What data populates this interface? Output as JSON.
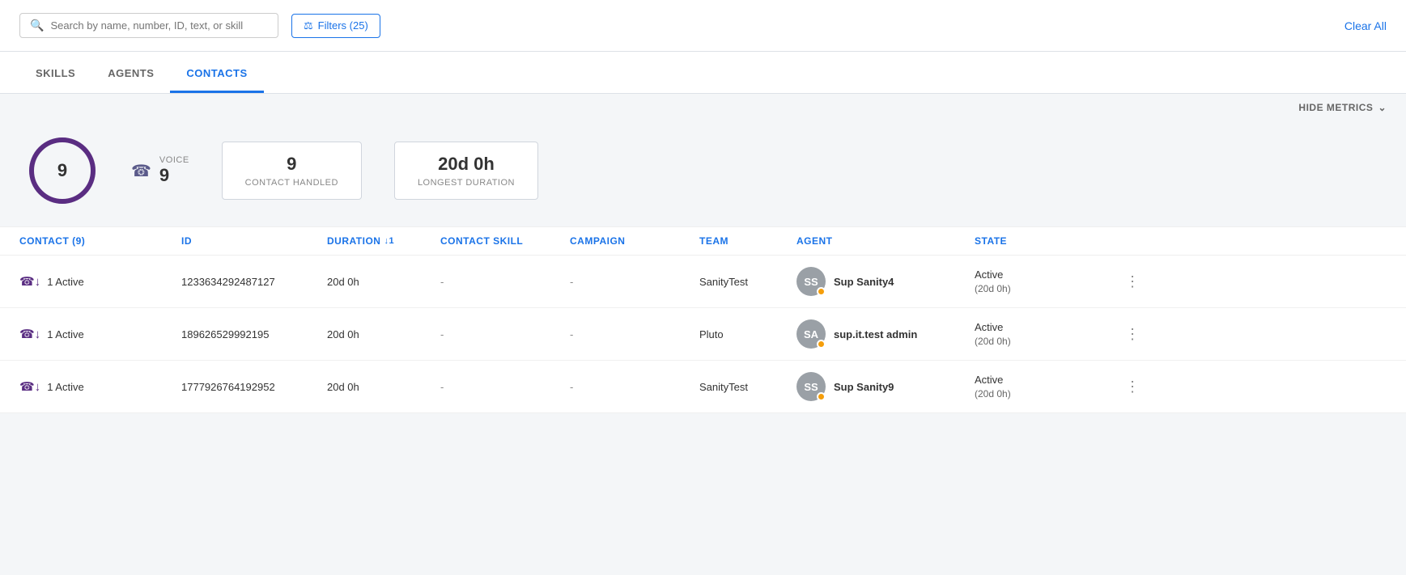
{
  "topbar": {
    "search_placeholder": "Search by name, number, ID, text, or skill",
    "filter_label": "Filters (25)",
    "clear_all_label": "Clear All"
  },
  "tabs": [
    {
      "id": "skills",
      "label": "SKILLS",
      "active": false
    },
    {
      "id": "agents",
      "label": "AGENTS",
      "active": false
    },
    {
      "id": "contacts",
      "label": "CONTACTS",
      "active": true
    }
  ],
  "metrics_toggle": {
    "label": "HIDE METRICS"
  },
  "metrics": {
    "total": 9,
    "voice_label": "VOICE",
    "voice_count": 9,
    "contact_handled_value": "9",
    "contact_handled_label": "CONTACT HANDLED",
    "longest_duration_value": "20d 0h",
    "longest_duration_label": "LONGEST DURATION"
  },
  "table": {
    "columns": [
      {
        "id": "contact",
        "label": "CONTACT (9)",
        "sortable": false
      },
      {
        "id": "id",
        "label": "ID",
        "sortable": false
      },
      {
        "id": "duration",
        "label": "DURATION",
        "sortable": true,
        "sort_indicator": "↓1"
      },
      {
        "id": "contact_skill",
        "label": "CONTACT SKILL",
        "sortable": false
      },
      {
        "id": "campaign",
        "label": "CAMPAIGN",
        "sortable": false
      },
      {
        "id": "team",
        "label": "TEAM",
        "sortable": false
      },
      {
        "id": "agent",
        "label": "AGENT",
        "sortable": false
      },
      {
        "id": "state",
        "label": "STATE",
        "sortable": false
      }
    ],
    "rows": [
      {
        "contact_icon": "📞",
        "contact_label": "1 Active",
        "id": "1233634292487127",
        "duration": "20d 0h",
        "contact_skill": "-",
        "campaign": "-",
        "team": "SanityTest",
        "agent_initials": "SS",
        "agent_name": "Sup Sanity4",
        "state_main": "Active",
        "state_sub": "(20d 0h)"
      },
      {
        "contact_icon": "📞",
        "contact_label": "1 Active",
        "id": "189626529992195",
        "duration": "20d 0h",
        "contact_skill": "-",
        "campaign": "-",
        "team": "Pluto",
        "agent_initials": "SA",
        "agent_name": "sup.it.test admin",
        "state_main": "Active",
        "state_sub": "(20d 0h)"
      },
      {
        "contact_icon": "📞",
        "contact_label": "1 Active",
        "id": "1777926764192952",
        "duration": "20d 0h",
        "contact_skill": "-",
        "campaign": "-",
        "team": "SanityTest",
        "agent_initials": "SS",
        "agent_name": "Sup Sanity9",
        "state_main": "Active",
        "state_sub": "(20d 0h)"
      }
    ]
  }
}
